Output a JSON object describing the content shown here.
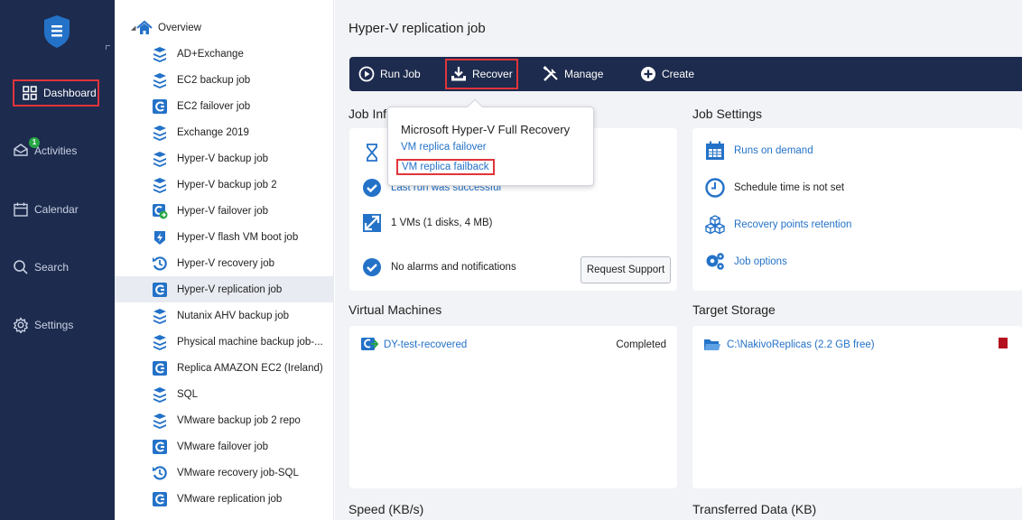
{
  "nav": {
    "items": [
      {
        "label": "Dashboard",
        "icon": "dashboard-icon"
      },
      {
        "label": "Activities",
        "icon": "activities-icon",
        "badge": "1"
      },
      {
        "label": "Calendar",
        "icon": "calendar-icon"
      },
      {
        "label": "Search",
        "icon": "search-icon"
      },
      {
        "label": "Settings",
        "icon": "settings-icon"
      }
    ]
  },
  "tree": {
    "root": "Overview",
    "items": [
      {
        "label": "AD+Exchange",
        "icon": "backup-job-icon"
      },
      {
        "label": "EC2 backup job",
        "icon": "backup-job-icon"
      },
      {
        "label": "EC2 failover job",
        "icon": "replication-job-icon"
      },
      {
        "label": "Exchange 2019",
        "icon": "backup-job-icon"
      },
      {
        "label": "Hyper-V backup job",
        "icon": "backup-job-icon"
      },
      {
        "label": "Hyper-V backup job 2",
        "icon": "backup-job-icon"
      },
      {
        "label": "Hyper-V failover job",
        "icon": "failover-job-icon"
      },
      {
        "label": "Hyper-V flash VM boot job",
        "icon": "flash-boot-icon"
      },
      {
        "label": "Hyper-V recovery job",
        "icon": "recovery-job-icon"
      },
      {
        "label": "Hyper-V replication job",
        "icon": "replication-job-icon"
      },
      {
        "label": "Nutanix AHV backup job",
        "icon": "backup-job-icon"
      },
      {
        "label": "Physical machine backup job-...",
        "icon": "backup-job-icon"
      },
      {
        "label": "Replica AMAZON EC2 (Ireland)",
        "icon": "replication-job-icon"
      },
      {
        "label": "SQL",
        "icon": "backup-job-icon"
      },
      {
        "label": "VMware backup job 2 repo",
        "icon": "backup-job-icon"
      },
      {
        "label": "VMware failover job",
        "icon": "replication-job-icon"
      },
      {
        "label": "VMware recovery job-SQL",
        "icon": "recovery-job-icon"
      },
      {
        "label": "VMware replication job",
        "icon": "replication-job-icon"
      }
    ]
  },
  "main": {
    "title": "Hyper-V replication job",
    "toolbar": {
      "run": "Run Job",
      "recover": "Recover",
      "manage": "Manage",
      "create": "Create"
    },
    "popup": {
      "title": "Microsoft Hyper-V Full Recovery",
      "item1": "VM replica failover",
      "item2": "VM replica failback"
    },
    "job_info": {
      "title": "Job Inf",
      "last_run": "Last run was successful",
      "vms": "1 VMs (1 disks, 4 MB)",
      "alarms": "No alarms and notifications",
      "support_button": "Request Support"
    },
    "job_settings": {
      "title": "Job Settings",
      "runs": "Runs on demand",
      "schedule": "Schedule time is not set",
      "retention": "Recovery points retention",
      "options": "Job options"
    },
    "virtual_machines": {
      "title": "Virtual Machines",
      "vm_name": "DY-test-recovered",
      "vm_status": "Completed"
    },
    "target_storage": {
      "title": "Target Storage",
      "path": "C:\\NakivoReplicas (2.2 GB free)"
    },
    "speed": {
      "title": "Speed (KB/s)"
    },
    "transferred": {
      "title": "Transferred Data (KB)"
    }
  },
  "colors": {
    "nav_bg": "#1d2b4e",
    "accent": "#2472c8",
    "highlight_box": "#e0353a"
  }
}
